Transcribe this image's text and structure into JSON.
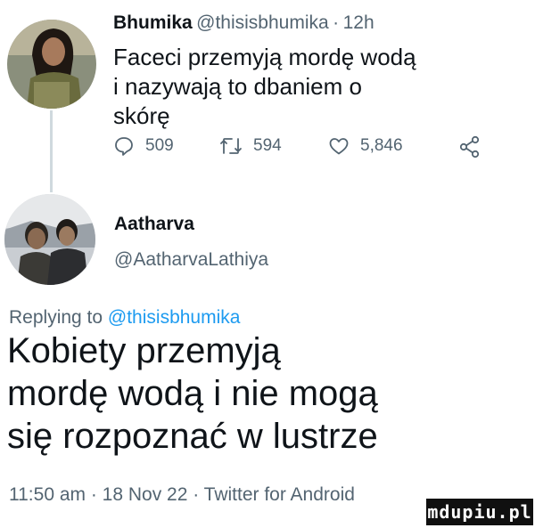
{
  "tweet": {
    "author_name": "Bhumika",
    "author_handle": "@thisisbhumika",
    "separator": "·",
    "time": "12h",
    "text": "Faceci przemyją mordę wodą i nazywają to dbaniem o skórę",
    "actions": {
      "replies": "509",
      "retweets": "594",
      "likes": "5,846"
    }
  },
  "reply": {
    "author_name": "Aatharva",
    "author_handle": "@AatharvaLathiya",
    "replying_to_label": "Replying to",
    "replying_to_handle": "@thisisbhumika",
    "text": "Kobiety przemyją mordę wodą i nie mogą się rozpoznać w lustrze",
    "footer": "11:50 am · 18 Nov 22 · Twitter for Android"
  },
  "icons": {
    "reply": "speech-bubble-icon",
    "retweet": "retweet-icon",
    "like": "heart-icon",
    "share": "share-icon"
  },
  "colors": {
    "text": "#0f1419",
    "secondary": "#536471",
    "link": "#1d9bf0"
  },
  "watermark": "mdupiu.pl"
}
